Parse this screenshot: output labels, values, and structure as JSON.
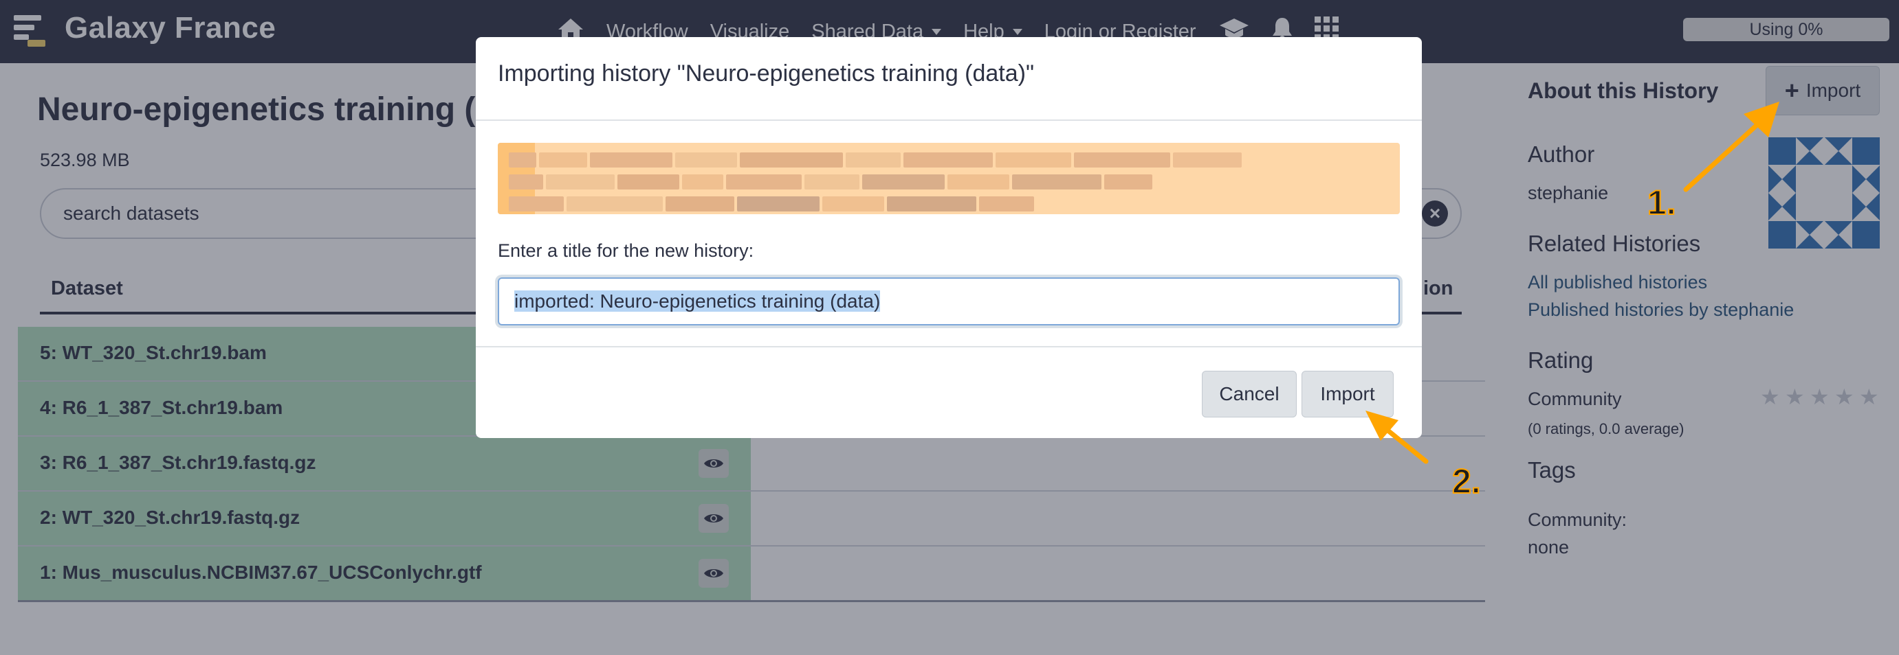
{
  "masthead": {
    "brand": "Galaxy France",
    "nav": {
      "home_icon": "home-icon",
      "workflow": "Workflow",
      "visualize": "Visualize",
      "shared_data": "Shared Data",
      "help": "Help",
      "login": "Login or Register",
      "training_icon": "graduation-cap-icon",
      "notifications_icon": "bell-icon",
      "apps_icon": "grid-icon"
    },
    "quota": "Using 0%"
  },
  "history": {
    "title": "Neuro-epigenetics training (",
    "size": "523.98 MB",
    "search_placeholder": "search datasets",
    "columns": {
      "dataset": "Dataset",
      "right": "ion"
    },
    "datasets": [
      {
        "name": "5: WT_320_St.chr19.bam",
        "eye": false
      },
      {
        "name": "4: R6_1_387_St.chr19.bam",
        "eye": false
      },
      {
        "name": "3: R6_1_387_St.chr19.fastq.gz",
        "eye": true
      },
      {
        "name": "2: WT_320_St.chr19.fastq.gz",
        "eye": true
      },
      {
        "name": "1: Mus_musculus.NCBIM37.67_UCSConlychr.gtf",
        "eye": true
      }
    ]
  },
  "sidebar": {
    "about": "About this History",
    "import_button": "Import",
    "author_heading": "Author",
    "author": "stephanie",
    "related_heading": "Related Histories",
    "all_published": "All published histories",
    "published_by": "Published histories by stephanie",
    "rating_heading": "Rating",
    "community_label": "Community",
    "ratings_summary": "(0 ratings, 0.0 average)",
    "rating_value": 0,
    "rating_max": 5,
    "tags_heading": "Tags",
    "community_tags_label": "Community:",
    "community_tags_value": "none"
  },
  "modal": {
    "title": "Importing history \"Neuro-epigenetics training (data)\"",
    "label": "Enter a title for the new history:",
    "input_value": "imported: Neuro-epigenetics training (data)",
    "cancel": "Cancel",
    "import": "Import"
  },
  "annotations": {
    "step1": "1.",
    "step2": "2."
  },
  "colors": {
    "masthead": "#2c3143",
    "dataset_ok": "#b3e0bf",
    "alert": "#fed7a8",
    "annotation_arrow": "#ffa500",
    "link": "#25537b"
  }
}
